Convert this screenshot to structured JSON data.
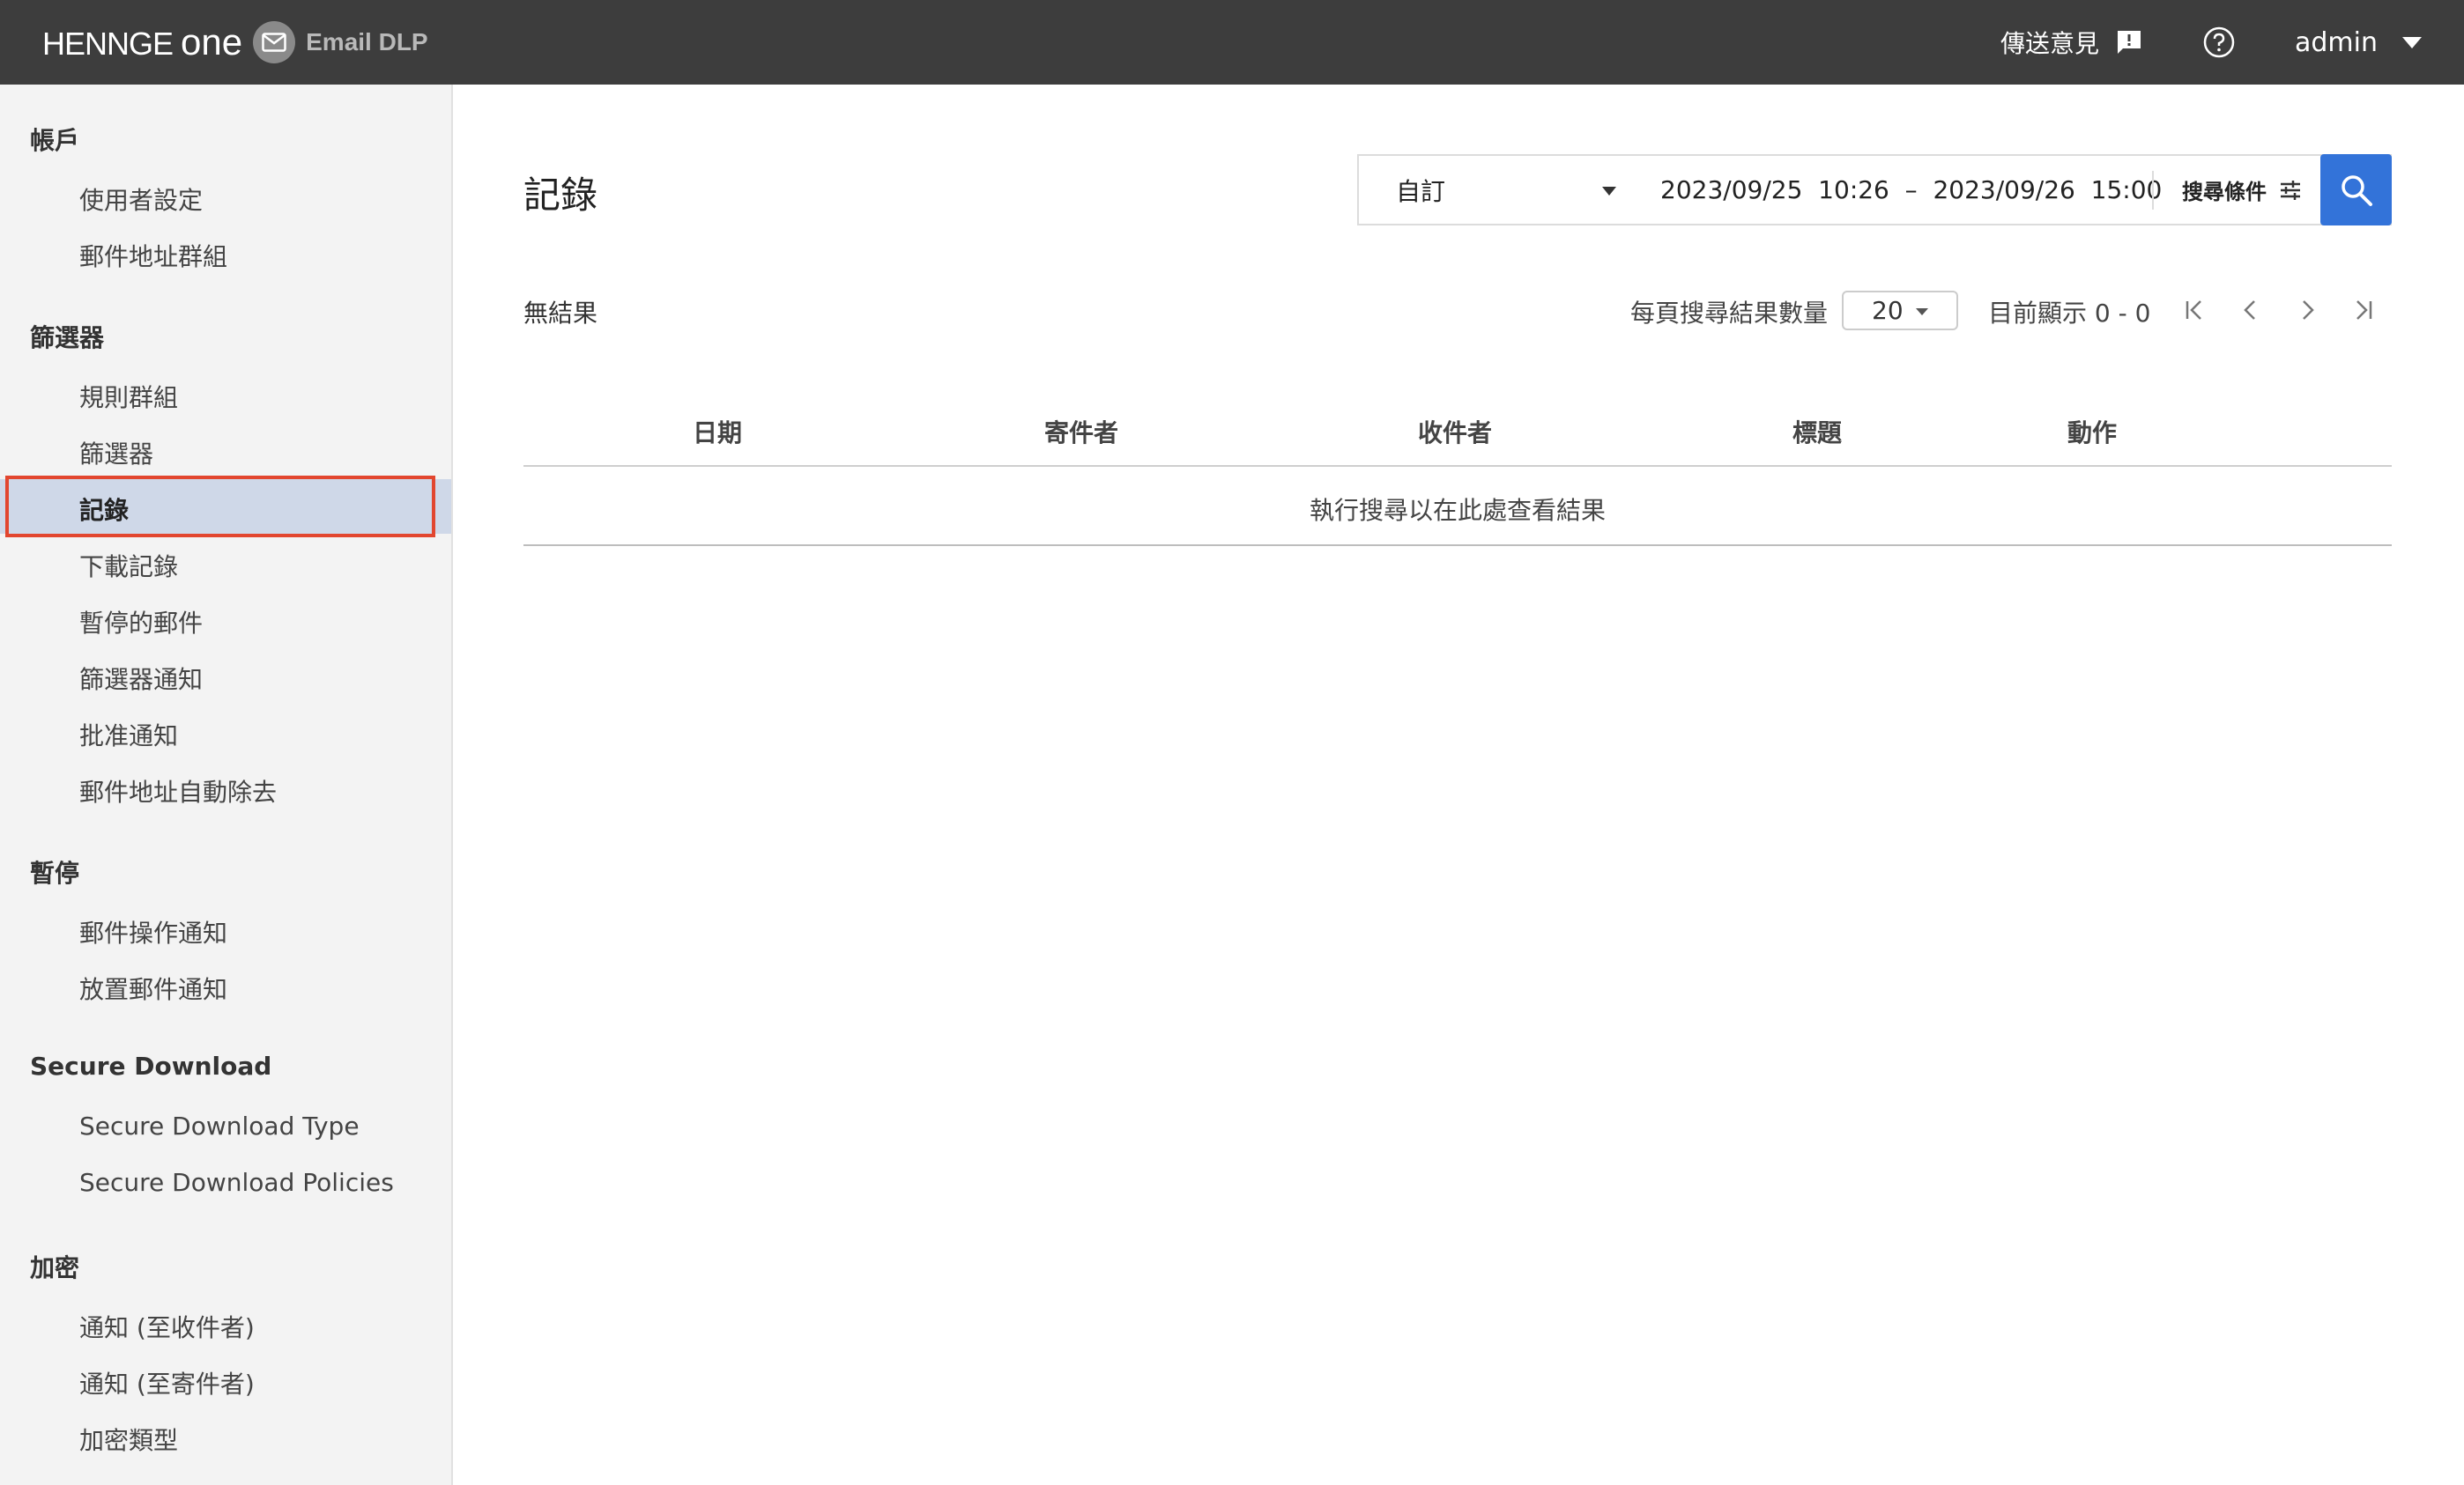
{
  "header": {
    "brand": "HENNGE",
    "brand_one": "one",
    "product": "Email DLP",
    "feedback_label": "傳送意見",
    "user_label": "admin"
  },
  "sidebar": {
    "sections": [
      {
        "title": "帳戶",
        "items": [
          "使用者設定",
          "郵件地址群組"
        ]
      },
      {
        "title": "篩選器",
        "items": [
          "規則群組",
          "篩選器",
          "記錄",
          "下載記錄",
          "暫停的郵件",
          "篩選器通知",
          "批准通知",
          "郵件地址自動除去"
        ]
      },
      {
        "title": "暫停",
        "items": [
          "郵件操作通知",
          "放置郵件通知"
        ]
      },
      {
        "title": "Secure Download",
        "items": [
          "Secure Download Type",
          "Secure Download Policies"
        ]
      },
      {
        "title": "加密",
        "items": [
          "通知 (至收件者)",
          "通知 (至寄件者)",
          "加密類型"
        ]
      }
    ],
    "active_item": "記錄"
  },
  "main": {
    "title": "記錄",
    "filter": {
      "range_label": "自訂",
      "date_range": "2023/09/25  10:26  –  2023/09/26  15:00",
      "criteria_label": "搜尋條件"
    },
    "results_text": "無結果",
    "per_page_label": "每頁搜尋結果數量",
    "per_page_value": "20",
    "showing_text": "目前顯示 0 - 0",
    "table": {
      "columns": [
        "日期",
        "寄件者",
        "收件者",
        "標題",
        "動作"
      ],
      "empty_message": "執行搜尋以在此處查看結果"
    }
  },
  "icons": [
    "mail-icon",
    "feedback-icon",
    "help-icon",
    "chevron-down-icon",
    "filter-settings-icon",
    "search-icon",
    "first-page-icon",
    "prev-page-icon",
    "next-page-icon",
    "last-page-icon"
  ],
  "colors": {
    "topbar": "#3d3d3d",
    "accent": "#3373d9",
    "active_bg": "#cfd8e8",
    "highlight_border": "#e2462f"
  }
}
